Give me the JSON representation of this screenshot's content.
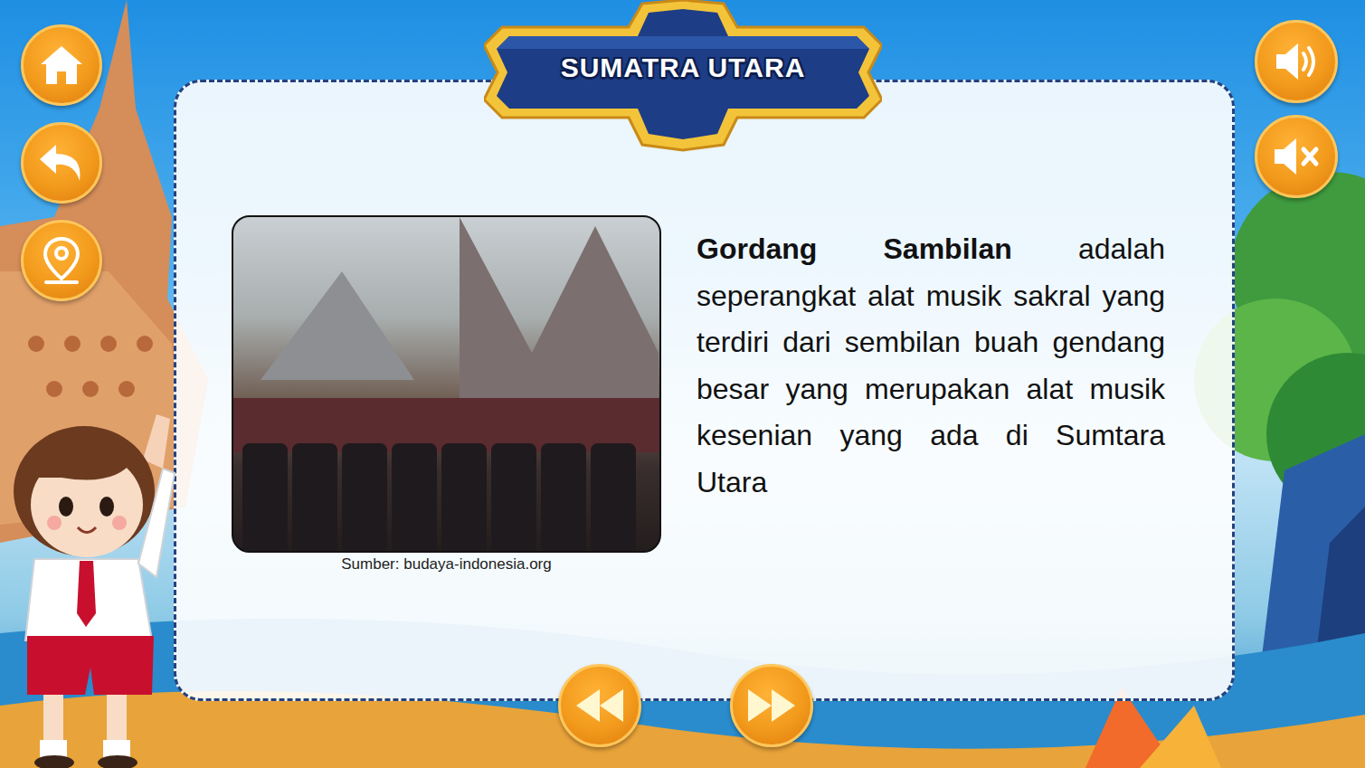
{
  "header": {
    "title": "SUMATRA UTARA"
  },
  "content": {
    "photo_caption": "Sumber: budaya-indonesia.org",
    "description": {
      "term": "Gordang Sambilan",
      "text": " adalah seperangkat alat musik sakral yang terdiri dari sembilan buah gendang besar yang merupakan alat musik kesenian yang ada di Sumtara Utara"
    }
  }
}
